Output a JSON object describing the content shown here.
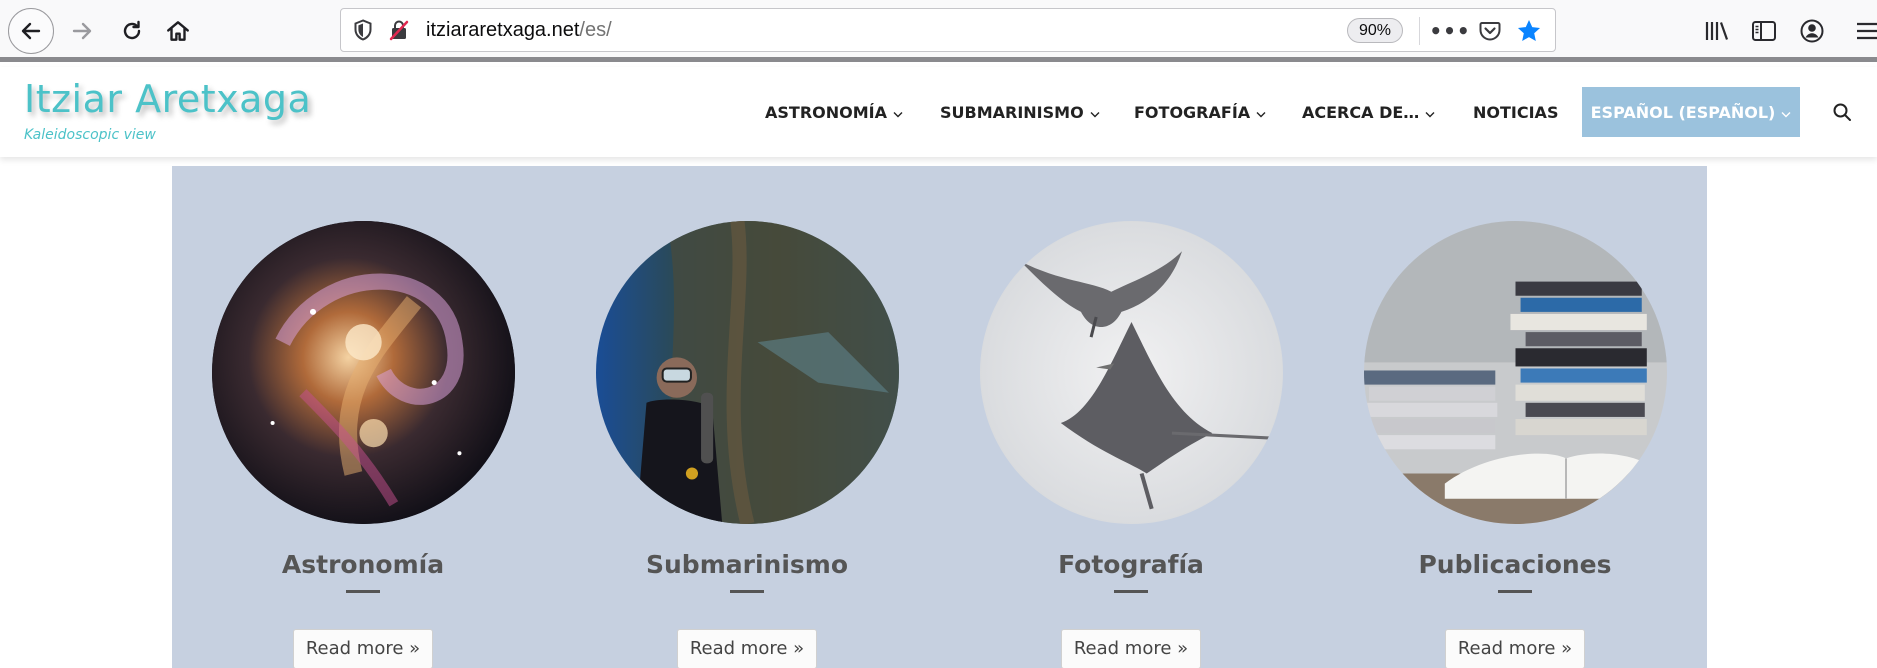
{
  "browser": {
    "url_domain": "itziararetxaga.net",
    "url_path": "/es/",
    "zoom": "90%",
    "more_label": "•••",
    "icons": {
      "back": "arrow-left-icon",
      "forward": "arrow-right-icon",
      "reload": "reload-icon",
      "home": "home-icon",
      "tracking": "shield-icon",
      "insecure": "insecure-lock-icon",
      "pocket": "pocket-icon",
      "bookmark": "star-icon",
      "library": "library-icon",
      "sidebar": "sidebar-icon",
      "account": "account-icon",
      "menu": "hamburger-icon"
    },
    "colors": {
      "bookmark_star": "#0a84ff"
    }
  },
  "site": {
    "logo": "Itziar Aretxaga",
    "tagline": "Kaleidoscopic view",
    "nav": [
      {
        "label": "ASTRONOMÍA",
        "has_dropdown": true
      },
      {
        "label": "SUBMARINISMO",
        "has_dropdown": true
      },
      {
        "label": "FOTOGRAFÍA",
        "has_dropdown": true
      },
      {
        "label": "ACERCA DE…",
        "has_dropdown": true
      },
      {
        "label": "NOTICIAS",
        "has_dropdown": false
      },
      {
        "label": "ESPAÑOL (ESPAÑOL)",
        "has_dropdown": true,
        "highlighted": true
      }
    ],
    "colors": {
      "brand": "#4cc2c8",
      "language_highlight": "#9bc2dd",
      "panel_background": "#c6d0e0"
    }
  },
  "cards": [
    {
      "title": "Astronomía",
      "button": "Read more »",
      "image": "galaxy-image"
    },
    {
      "title": "Submarinismo",
      "button": "Read more »",
      "image": "diver-image"
    },
    {
      "title": "Fotografía",
      "button": "Read more »",
      "image": "manta-ray-image"
    },
    {
      "title": "Publicaciones",
      "button": "Read more »",
      "image": "books-image"
    }
  ]
}
